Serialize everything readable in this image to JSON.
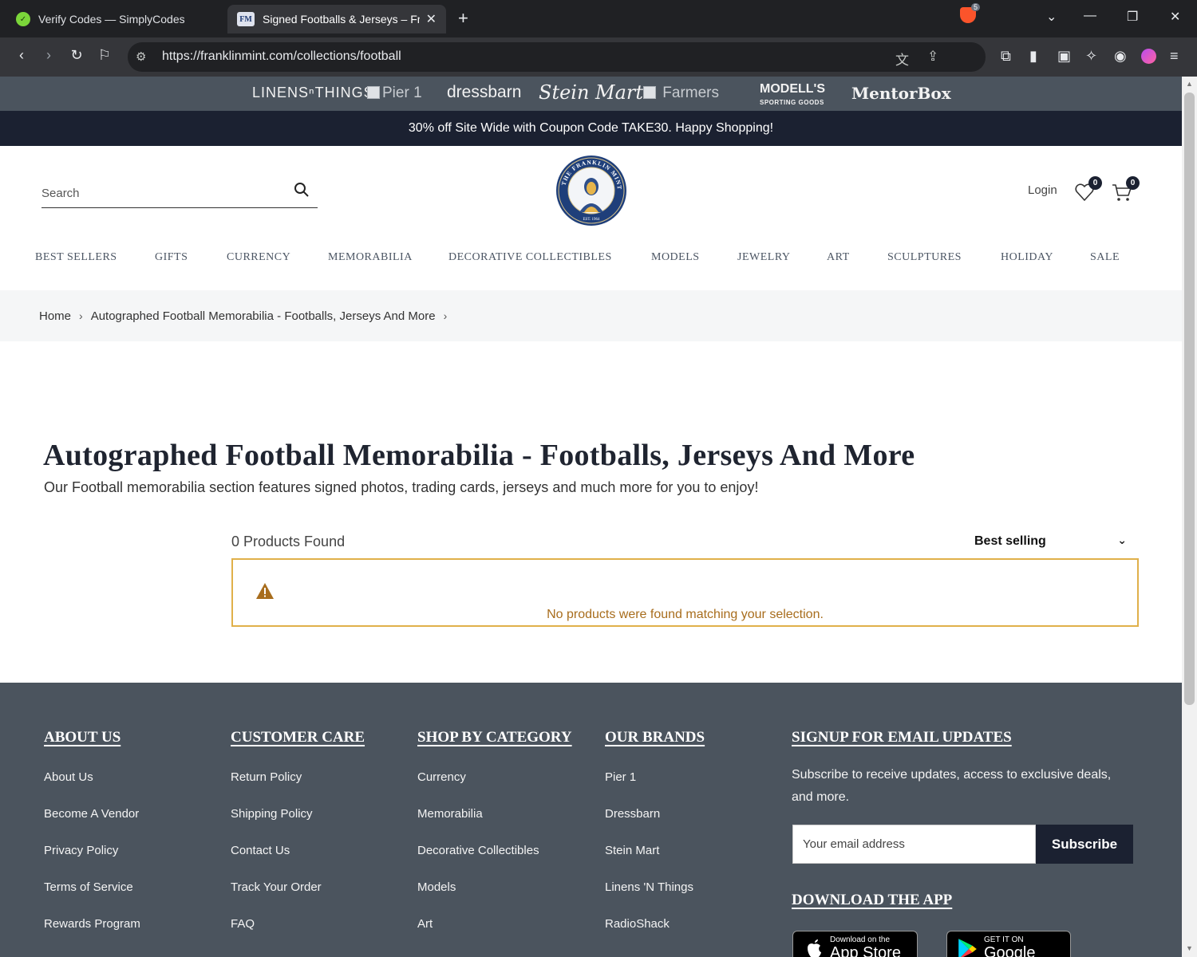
{
  "browser": {
    "tabs": [
      {
        "title": "Verify Codes — SimplyCodes",
        "active": false
      },
      {
        "title": "Signed Footballs & Jerseys – Franklin Mint",
        "active": true
      }
    ],
    "tab_favicon_text": "FM",
    "url": "https://franklinmint.com/collections/football",
    "brave_badge": "5"
  },
  "brands": {
    "linens": "LINENSⁿTHINGS",
    "pier": "Pier 1",
    "dressbarn": "dressbarn",
    "stein": "Stein Mart",
    "farmers": "Farmers",
    "modells_top": "MODELL'S",
    "modells_bottom": "SPORTING GOODS",
    "mentorbox": "MentorBox"
  },
  "promo": "30% off Site Wide with Coupon Code TAKE30. Happy Shopping!",
  "header": {
    "search_placeholder": "Search",
    "login": "Login",
    "wishlist_count": "0",
    "cart_count": "0",
    "logo_text": "THE FRANKLIN MINT",
    "logo_est": "EST. 1964"
  },
  "nav": [
    "BEST SELLERS",
    "GIFTS",
    "CURRENCY",
    "MEMORABILIA",
    "DECORATIVE COLLECTIBLES",
    "MODELS",
    "JEWELRY",
    "ART",
    "SCULPTURES",
    "HOLIDAY",
    "SALE"
  ],
  "breadcrumb": {
    "home": "Home",
    "current": "Autographed Football Memorabilia - Footballs, Jerseys And More"
  },
  "collection": {
    "title": "Autographed Football Memorabilia - Footballs, Jerseys And More",
    "description": "Our Football memorabilia section features signed photos, trading cards, jerseys and much more for you to enjoy!",
    "count_label": "0 Products Found",
    "sort_label": "Best selling",
    "empty_message": "No products were found matching your selection."
  },
  "footer": {
    "about": {
      "title": "ABOUT US",
      "links": [
        "About Us",
        "Become A Vendor",
        "Privacy Policy",
        "Terms of Service",
        "Rewards Program"
      ]
    },
    "care": {
      "title": "CUSTOMER CARE",
      "links": [
        "Return Policy",
        "Shipping Policy",
        "Contact Us",
        "Track Your Order",
        "FAQ"
      ]
    },
    "category": {
      "title": "SHOP BY CATEGORY",
      "links": [
        "Currency",
        "Memorabilia",
        "Decorative Collectibles",
        "Models",
        "Art"
      ]
    },
    "brands": {
      "title": "OUR BRANDS",
      "links": [
        "Pier 1",
        "Dressbarn",
        "Stein Mart",
        "Linens 'N Things",
        "RadioShack"
      ]
    },
    "newsletter": {
      "title": "SIGNUP FOR EMAIL UPDATES",
      "text": "Subscribe to receive updates, access to exclusive deals, and more.",
      "email_placeholder": "Your email address",
      "button": "Subscribe"
    },
    "app": {
      "title": "DOWNLOAD THE APP",
      "appstore_small": "Download on the",
      "appstore_big": "App Store",
      "google_small": "GET IT ON",
      "google_big": "Google Play"
    }
  },
  "colors": {
    "brandbar": "#4b545e",
    "promo": "#1b2131",
    "warning_border": "#e0b04a",
    "warning_text": "#a86d1d",
    "footer": "#4b545e"
  }
}
